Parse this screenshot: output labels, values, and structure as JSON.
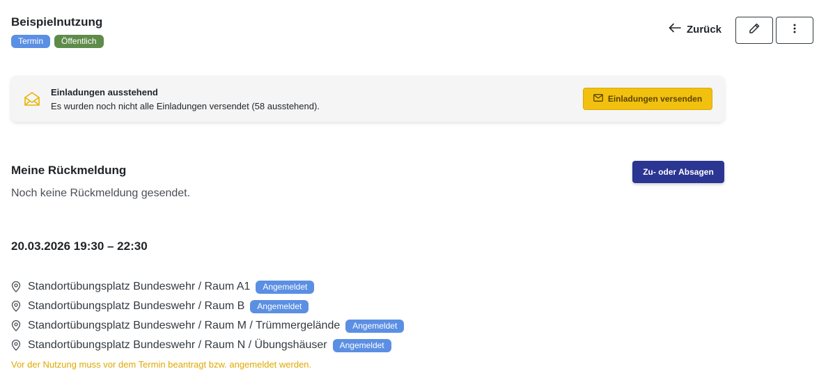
{
  "header": {
    "title": "Beispielnutzung",
    "badges": [
      "Termin",
      "Öffentlich"
    ],
    "back_label": "Zurück"
  },
  "alert": {
    "title": "Einladungen ausstehend",
    "text": "Es wurden noch nicht alle Einladungen versendet (58 ausstehend).",
    "button_label": "Einladungen versenden"
  },
  "response": {
    "title": "Meine Rückmeldung",
    "text": "Noch keine Rückmeldung gesendet.",
    "button_label": "Zu- oder Absagen"
  },
  "event": {
    "date": "20.03.2026 19:30 – 22:30",
    "locations": [
      {
        "name": "Standortübungsplatz Bundeswehr / Raum A1",
        "status": "Angemeldet"
      },
      {
        "name": "Standortübungsplatz Bundeswehr / Raum B",
        "status": "Angemeldet"
      },
      {
        "name": "Standortübungsplatz Bundeswehr / Raum M / Trümmergelände",
        "status": "Angemeldet"
      },
      {
        "name": "Standortübungsplatz Bundeswehr / Raum N / Übungshäuser",
        "status": "Angemeldet"
      }
    ],
    "note": "Vor der Nutzung muss vor dem Termin beantragt bzw. angemeldet werden."
  },
  "colors": {
    "badge_blue": "#5b8fe3",
    "badge_green": "#5e8b4a",
    "warning_button": "#f2c00e",
    "primary_button": "#2b3592",
    "note_text": "#e0a800"
  }
}
